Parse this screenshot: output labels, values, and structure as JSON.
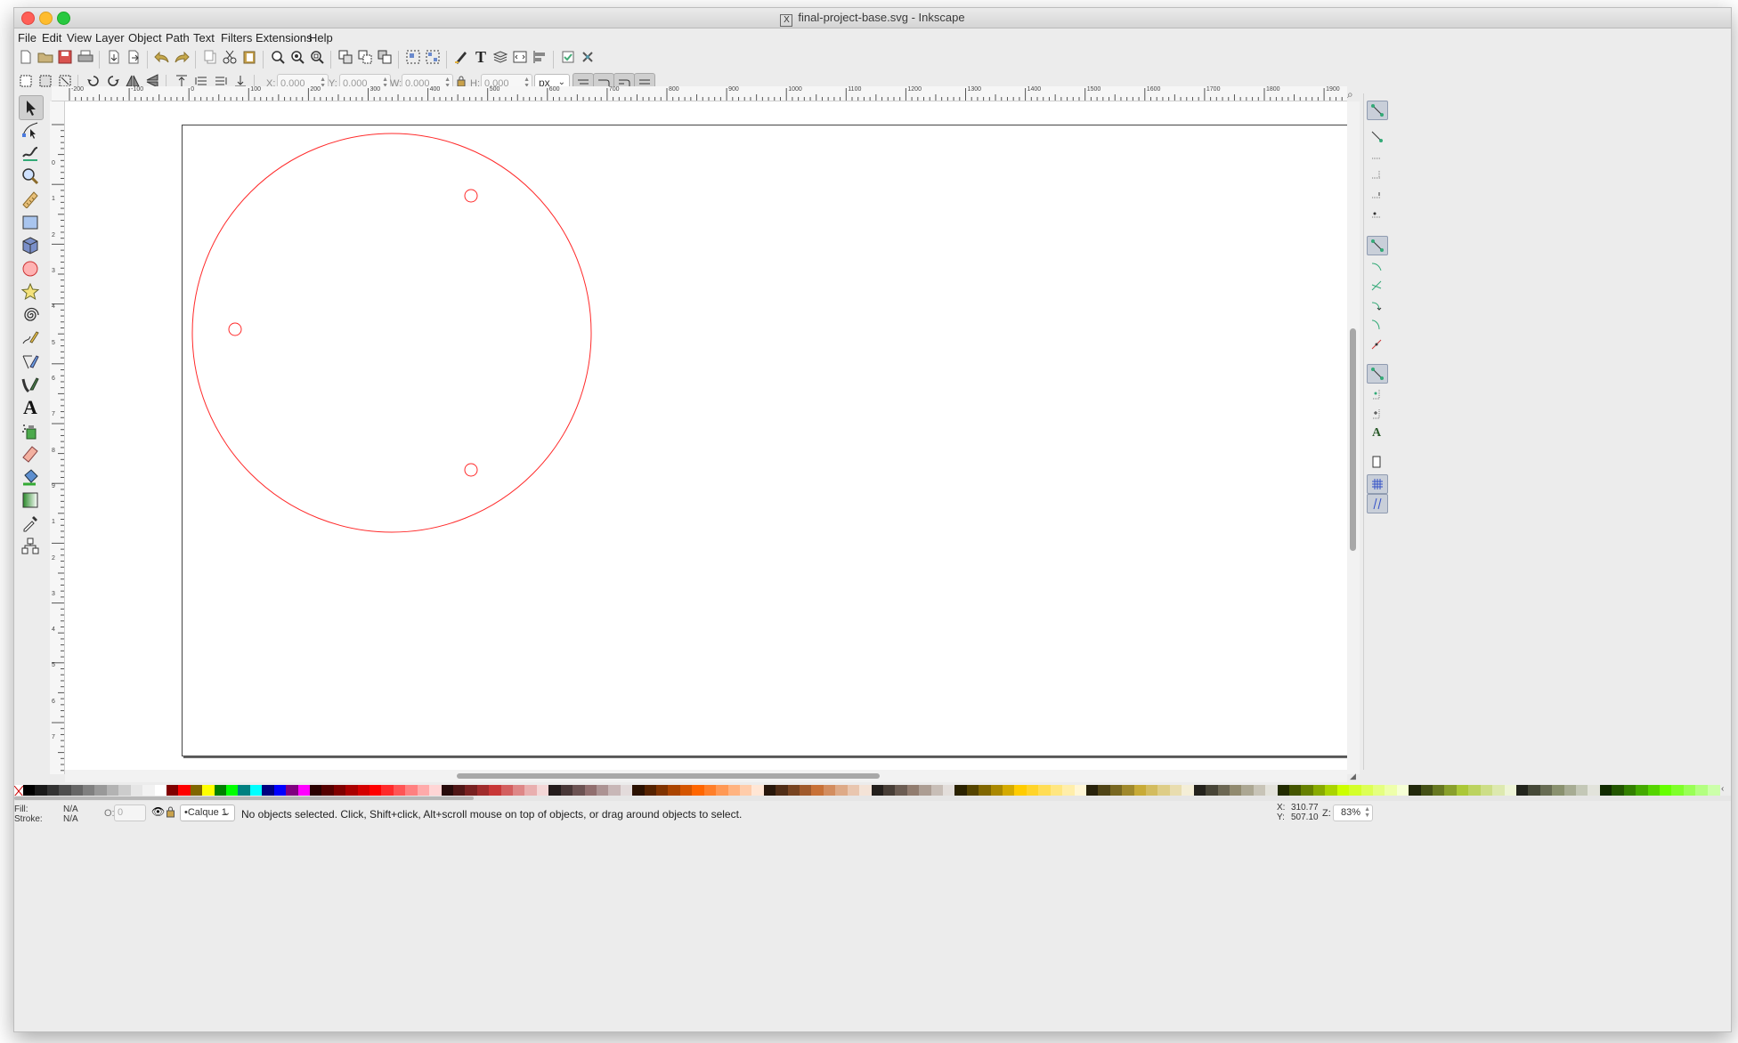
{
  "window": {
    "title": "final-project-base.svg - Inkscape"
  },
  "menu": [
    "File",
    "Edit",
    "View",
    "Layer",
    "Object",
    "Path",
    "Text",
    "Filters",
    "Extensions",
    "Help"
  ],
  "icons": {
    "command_bar": [
      "new-document-icon",
      "open-icon",
      "save-icon",
      "print-icon",
      "import-icon",
      "export-icon",
      "undo-icon",
      "redo-icon",
      "copy-icon",
      "cut-icon",
      "paste-icon",
      "zoom-selection-icon",
      "zoom-drawing-icon",
      "zoom-page-icon",
      "duplicate-icon",
      "clone-icon",
      "unlink-clone-icon",
      "group-icon",
      "ungroup-icon",
      "fill-stroke-icon",
      "text-font-icon",
      "layers-icon",
      "xml-editor-icon",
      "align-distribute-icon",
      "preferences-icon",
      "document-properties-icon"
    ],
    "tools": [
      "selector-tool-icon",
      "node-tool-icon",
      "tweak-tool-icon",
      "zoom-tool-icon",
      "measure-tool-icon",
      "rectangle-tool-icon",
      "3d-box-tool-icon",
      "ellipse-tool-icon",
      "star-tool-icon",
      "spiral-tool-icon",
      "pencil-tool-icon",
      "pen-tool-icon",
      "calligraphy-tool-icon",
      "text-tool-icon",
      "spray-tool-icon",
      "eraser-tool-icon",
      "paint-bucket-tool-icon",
      "gradient-tool-icon",
      "dropper-tool-icon",
      "connector-tool-icon"
    ]
  },
  "selector_toolbar": {
    "x_label": "X:",
    "x_value": "0.000",
    "y_label": "Y:",
    "y_value": "0.000",
    "w_label": "W:",
    "w_value": "0.000",
    "h_label": "H:",
    "h_value": "0.000",
    "unit": "px"
  },
  "ruler_labels": [
    "-200",
    "-100",
    "0",
    "100",
    "200",
    "300",
    "400",
    "500",
    "600",
    "700",
    "800",
    "900",
    "1000",
    "1100",
    "1200",
    "1300",
    "1400",
    "1500",
    "1600",
    "1700",
    "1800",
    "1900"
  ],
  "vruler_labels": [
    "0",
    "1",
    "2",
    "3",
    "4",
    "5",
    "6",
    "7",
    "8",
    "9",
    "1",
    "2",
    "3",
    "4",
    "5",
    "6",
    "7",
    "8",
    "9",
    "1"
  ],
  "colors": {
    "stroke": "#ff2a2a",
    "palette": [
      "#000000",
      "#1a1a1a",
      "#333333",
      "#4d4d4d",
      "#666666",
      "#808080",
      "#999999",
      "#b3b3b3",
      "#cccccc",
      "#e6e6e6",
      "#f2f2f2",
      "#ffffff",
      "#800000",
      "#ff0000",
      "#806600",
      "#ffff00",
      "#008000",
      "#00ff00",
      "#008080",
      "#00ffff",
      "#000080",
      "#0000ff",
      "#800080",
      "#ff00ff",
      "#2b0000",
      "#550000",
      "#800000",
      "#aa0000",
      "#d40000",
      "#ff0000",
      "#ff2a2a",
      "#ff5555",
      "#ff8080",
      "#ffaaaa",
      "#ffd5d5",
      "#280b0b",
      "#501616",
      "#782121",
      "#a02c2c",
      "#c83737",
      "#d35f5f",
      "#de8787",
      "#e9afaf",
      "#f4d7d7",
      "#241c1c",
      "#483737",
      "#6c5353",
      "#916f6f",
      "#ac9393",
      "#c8b7b7",
      "#e3dbdb",
      "#2b1100",
      "#552200",
      "#803300",
      "#aa4400",
      "#d45500",
      "#ff6600",
      "#ff7f2a",
      "#ff9955",
      "#ffb380",
      "#ffccaa",
      "#ffe6d5",
      "#28170b",
      "#502d16",
      "#784421",
      "#a05a2c",
      "#c87137",
      "#d38d5f",
      "#deaa87",
      "#e9c6af",
      "#f4e3d7",
      "#241f1c",
      "#483e37",
      "#6c5d53",
      "#917c6f",
      "#ac9d93",
      "#c8beb7",
      "#e3dedb",
      "#2b2200",
      "#554400",
      "#806600",
      "#aa8800",
      "#d4aa00",
      "#ffcc00",
      "#ffd42a",
      "#ffdd55",
      "#ffe680",
      "#ffeeaa",
      "#fff6d5",
      "#28220b",
      "#504416",
      "#786721",
      "#a0892c",
      "#c8ab37",
      "#d3bc5f",
      "#decd87",
      "#e9ddaf",
      "#f4eed7",
      "#24221c",
      "#484537",
      "#6c6753",
      "#918a6f",
      "#aca793",
      "#c8c4b7",
      "#e3e2db",
      "#222b00",
      "#445500",
      "#668000",
      "#88aa00",
      "#aad400",
      "#ccff00",
      "#d4ff2a",
      "#ddff55",
      "#e5ff80",
      "#eeffaa",
      "#f6ffd5",
      "#22280b",
      "#445016",
      "#677821",
      "#89a02c",
      "#abc837",
      "#bcd35f",
      "#cdde87",
      "#dde9af",
      "#eef4d7",
      "#22241c",
      "#454837",
      "#676c53",
      "#8a916f",
      "#a7ac93",
      "#c4c8b7",
      "#e2e3db",
      "#112b00",
      "#225500",
      "#338000",
      "#44aa00",
      "#55d400",
      "#66ff00",
      "#7fff2a",
      "#99ff55",
      "#b3ff80",
      "#ccffaa"
    ]
  },
  "status": {
    "fill_label": "Fill:",
    "fill_value": "N/A",
    "stroke_label": "Stroke:",
    "stroke_value": "N/A",
    "opacity_label": "O:",
    "opacity_value": "0",
    "layer": "•Calque 1",
    "message": "No objects selected. Click, Shift+click, Alt+scroll mouse on top of objects, or drag around objects to select.",
    "x_label": "X:",
    "x_value": "310.77",
    "y_label": "Y:",
    "y_value": "507.10",
    "zoom_label": "Z:",
    "zoom_value": "83%"
  }
}
